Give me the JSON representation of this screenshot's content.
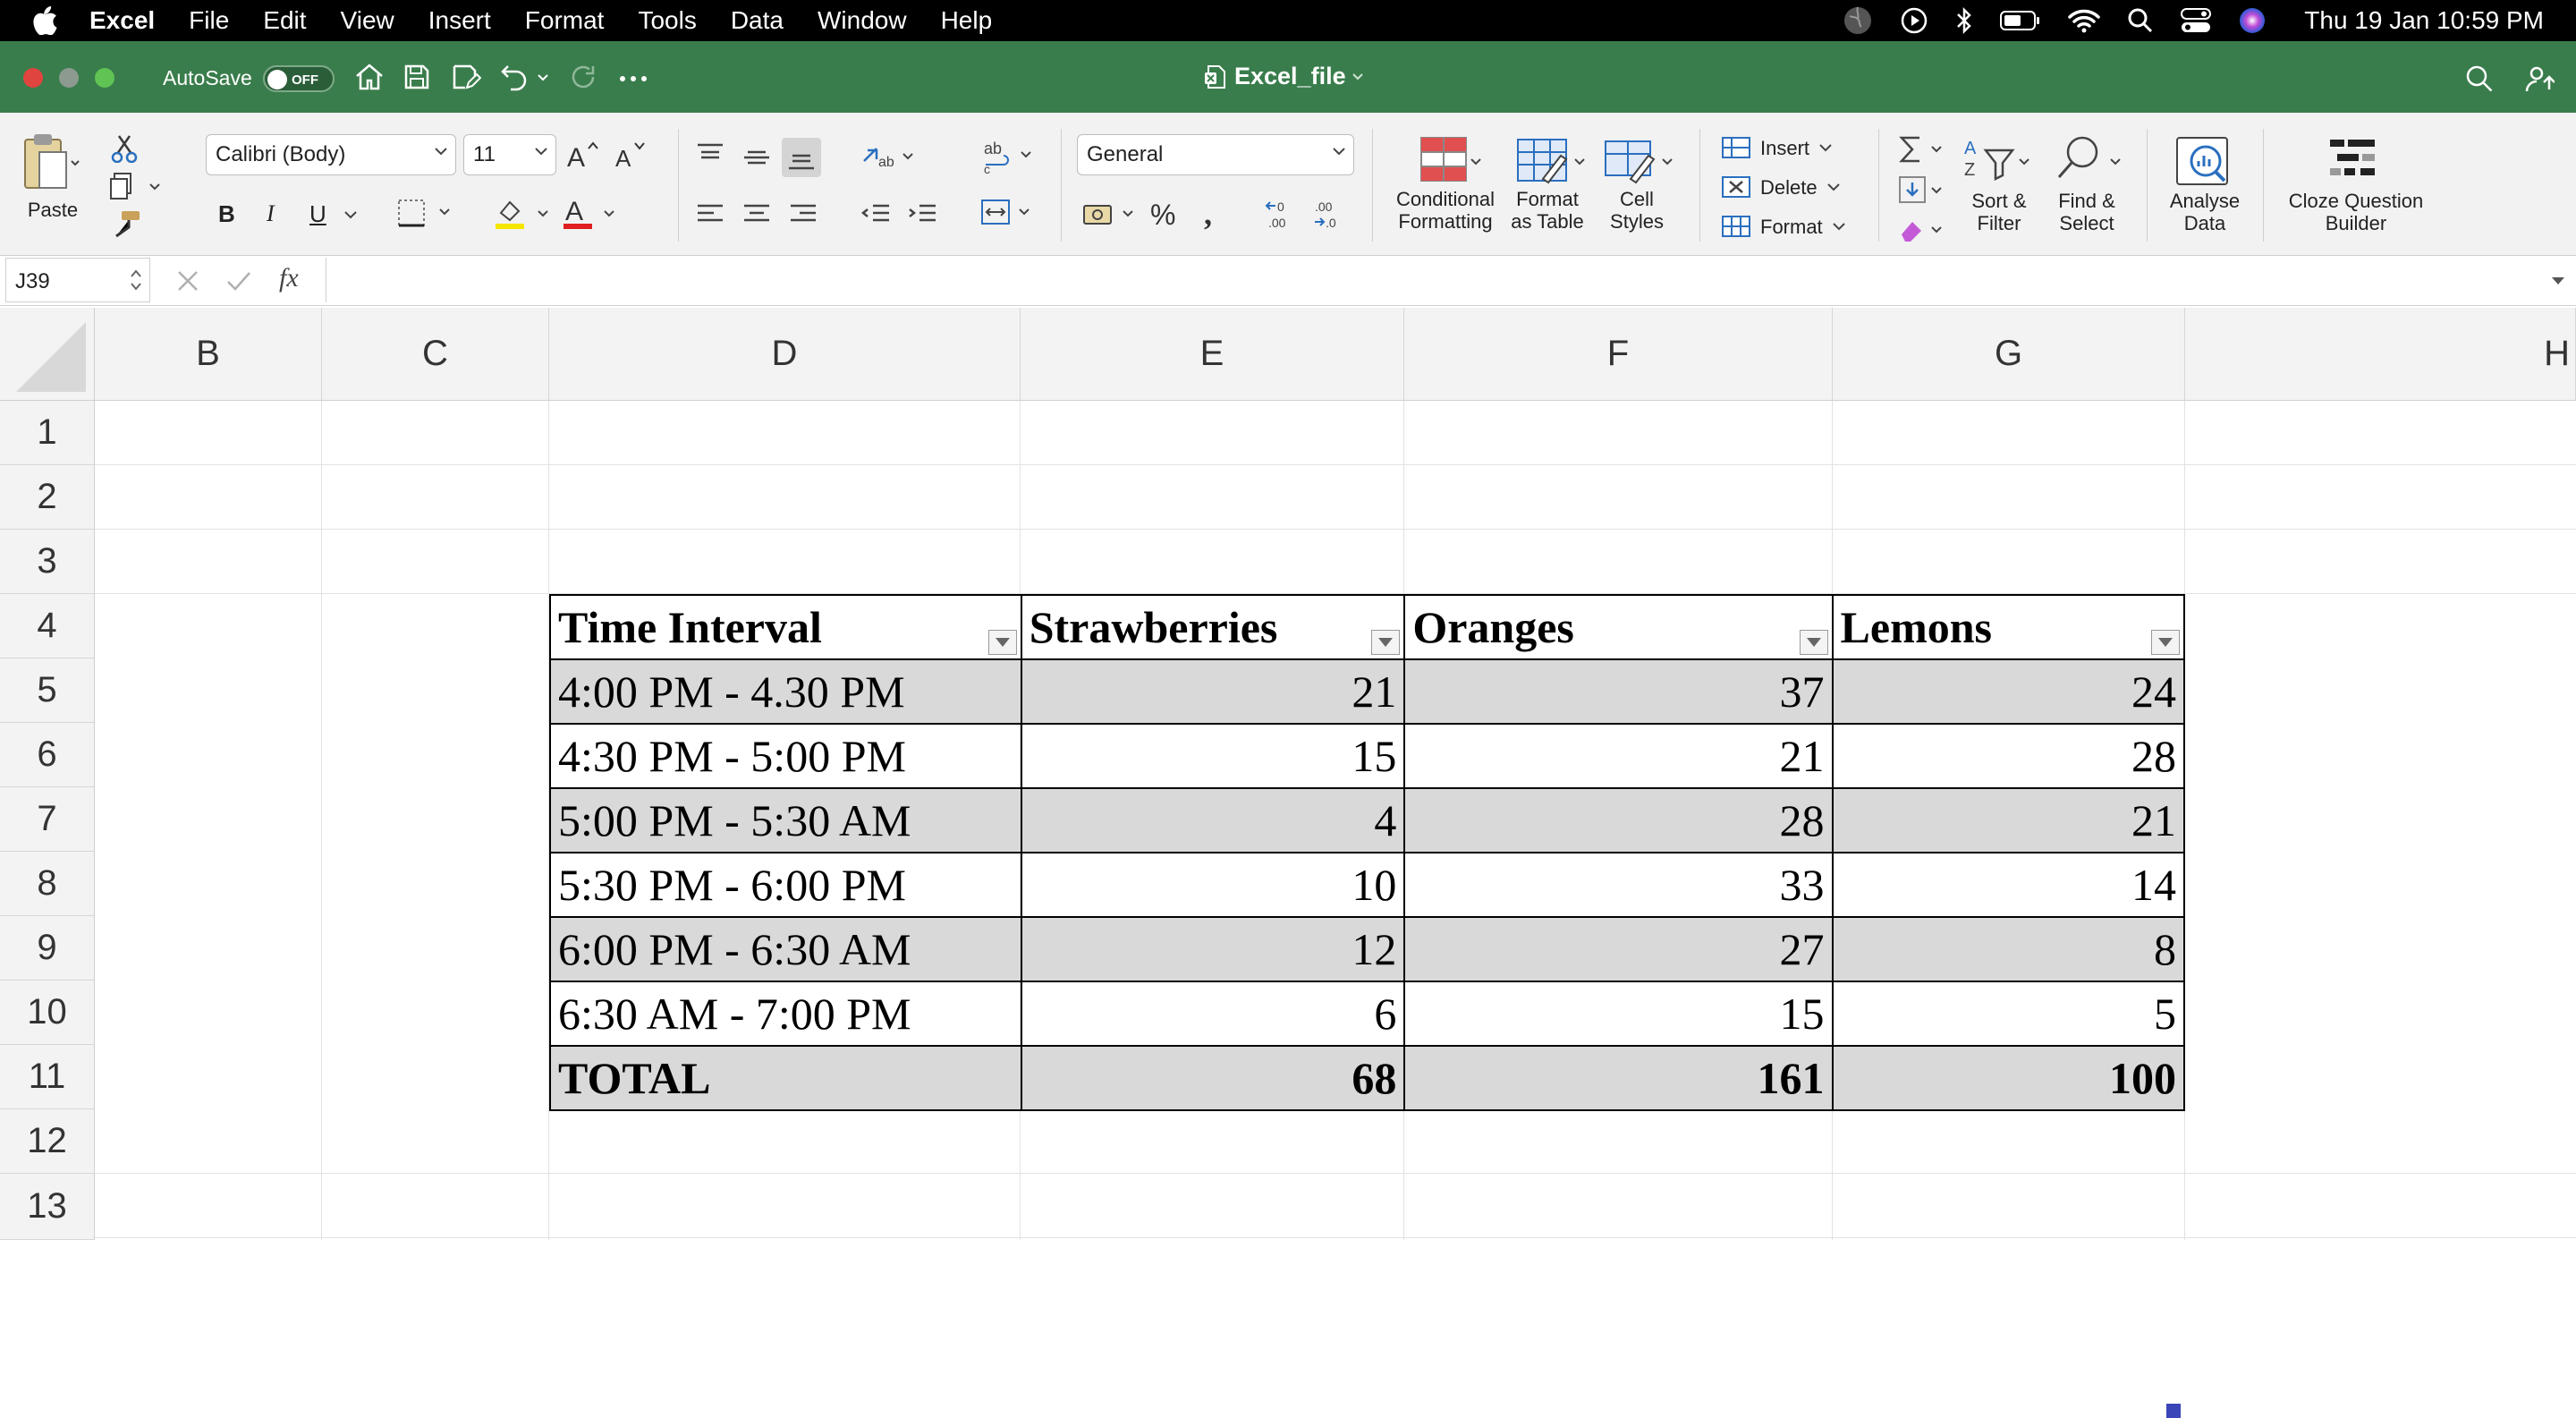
{
  "menubar": {
    "app_name": "Excel",
    "items": [
      "File",
      "Edit",
      "View",
      "Insert",
      "Format",
      "Tools",
      "Data",
      "Window",
      "Help"
    ],
    "clock": "Thu 19 Jan  10:59 PM"
  },
  "titlebar": {
    "autosave_label": "AutoSave",
    "autosave_state": "OFF",
    "document_title": "Excel_file"
  },
  "ribbon": {
    "paste_label": "Paste",
    "font_name": "Calibri (Body)",
    "font_size": "11",
    "number_format": "General",
    "conditional_formatting": [
      "Conditional",
      "Formatting"
    ],
    "format_as_table": [
      "Format",
      "as Table"
    ],
    "cell_styles": [
      "Cell",
      "Styles"
    ],
    "insert_label": "Insert",
    "delete_label": "Delete",
    "format_label": "Format",
    "sort_filter": [
      "Sort &",
      "Filter"
    ],
    "find_select": [
      "Find &",
      "Select"
    ],
    "analyse_data": [
      "Analyse",
      "Data"
    ],
    "cloze_builder": [
      "Cloze Question",
      "Builder"
    ]
  },
  "formula_bar": {
    "cell_ref": "J39",
    "fx_label": "fx",
    "content": ""
  },
  "sheet": {
    "columns": [
      "B",
      "C",
      "D",
      "E",
      "F",
      "G",
      "H"
    ],
    "rows": [
      "1",
      "2",
      "3",
      "4",
      "5",
      "6",
      "7",
      "8",
      "9",
      "10",
      "11",
      "12",
      "13"
    ],
    "table": {
      "headers": [
        "Time Interval",
        "Strawberries",
        "Oranges",
        "Lemons"
      ],
      "rows": [
        [
          "4:00 PM - 4.30 PM",
          "21",
          "37",
          "24"
        ],
        [
          "4:30 PM - 5:00 PM",
          "15",
          "21",
          "28"
        ],
        [
          "5:00 PM - 5:30 AM",
          "4",
          "28",
          "21"
        ],
        [
          "5:30 PM - 6:00 PM",
          "10",
          "33",
          "14"
        ],
        [
          "6:00 PM - 6:30 AM",
          "12",
          "27",
          "8"
        ],
        [
          "6:30 AM - 7:00 PM",
          "6",
          "15",
          "5"
        ]
      ],
      "total": [
        "TOTAL",
        "68",
        "161",
        "100"
      ]
    }
  },
  "colors": {
    "titlebar": "#3a7d4c",
    "menubar": "#000000",
    "ribbon": "#f2f2f2",
    "band": "#d9d9d9",
    "fill_handle": "#3a45b8",
    "font_color_bar": "#e02020",
    "highlight_bar": "#f5e600"
  },
  "icons": [
    "apple-icon",
    "home-icon",
    "save-icon",
    "save-as-icon",
    "undo-icon",
    "redo-icon",
    "more-icon",
    "search-icon",
    "share-icon",
    "wifi-icon",
    "bluetooth-icon",
    "battery-icon",
    "control-center-icon",
    "siri-icon",
    "play-icon",
    "vpn-icon"
  ]
}
